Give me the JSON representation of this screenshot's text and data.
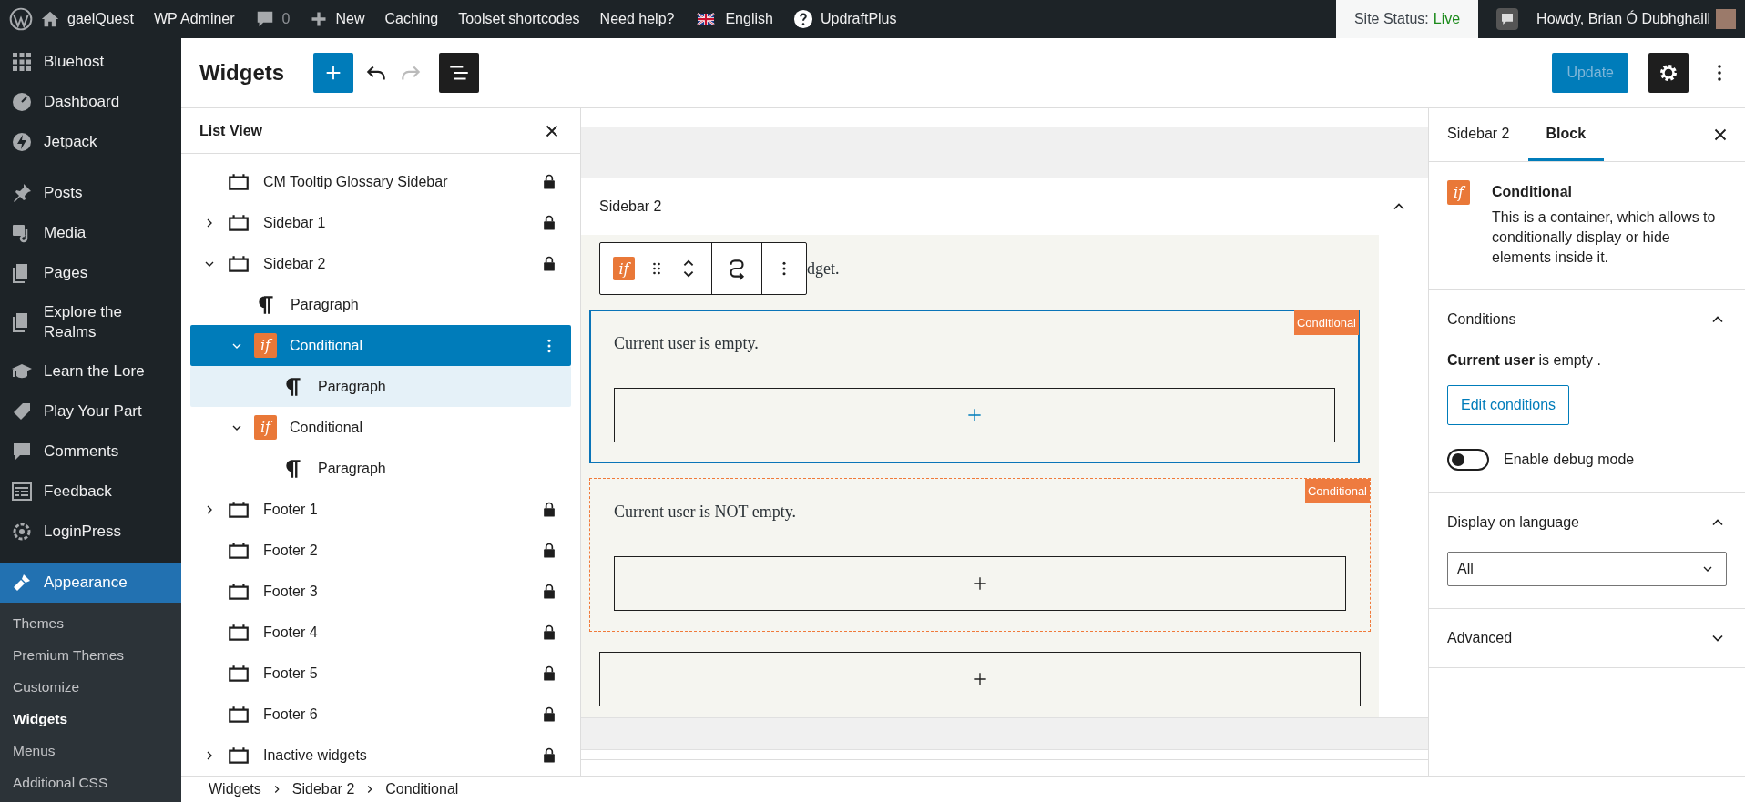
{
  "admin_bar": {
    "left": [
      {
        "kind": "wp-logo"
      },
      {
        "kind": "home",
        "label": "gaelQuest"
      },
      {
        "kind": "text",
        "label": "WP Adminer"
      },
      {
        "kind": "comments",
        "label": "0"
      },
      {
        "kind": "new",
        "label": "New"
      },
      {
        "kind": "text",
        "label": "Caching"
      },
      {
        "kind": "text",
        "label": "Toolset shortcodes"
      },
      {
        "kind": "text",
        "label": "Need help?"
      },
      {
        "kind": "language",
        "label": "English"
      },
      {
        "kind": "text",
        "label": "UpdraftPlus"
      }
    ],
    "site_status": {
      "label": "Site Status:",
      "value": "Live"
    },
    "howdy": "Howdy, Brian Ó Dubhghaill"
  },
  "admin_menu": {
    "groups": [
      [
        {
          "label": "Bluehost",
          "current": false
        },
        {
          "label": "Dashboard",
          "current": false
        },
        {
          "label": "Jetpack",
          "current": false
        }
      ],
      [
        {
          "label": "Posts",
          "current": false
        },
        {
          "label": "Media",
          "current": false
        },
        {
          "label": "Pages",
          "current": false
        },
        {
          "label": "Explore the Realms",
          "current": false
        },
        {
          "label": "Learn the Lore",
          "current": false
        },
        {
          "label": "Play Your Part",
          "current": false
        },
        {
          "label": "Comments",
          "current": false
        },
        {
          "label": "Feedback",
          "current": false
        },
        {
          "label": "LoginPress",
          "current": false
        }
      ],
      [
        {
          "label": "Appearance",
          "current": true
        }
      ]
    ],
    "submenu": [
      {
        "label": "Themes",
        "selected": false
      },
      {
        "label": "Premium Themes",
        "selected": false
      },
      {
        "label": "Customize",
        "selected": false
      },
      {
        "label": "Widgets",
        "selected": true
      },
      {
        "label": "Menus",
        "selected": false
      },
      {
        "label": "Additional CSS",
        "selected": false
      }
    ]
  },
  "header": {
    "title": "Widgets",
    "update": "Update"
  },
  "list_view": {
    "title": "List View",
    "items": [
      {
        "kind": "widget-area",
        "label": "CM Tooltip Glossary Sidebar",
        "locked": true,
        "selected": false,
        "highlighted": false
      },
      {
        "kind": "widget-area",
        "label": "Sidebar 1",
        "expanded": false,
        "locked": true,
        "selected": false,
        "highlighted": false
      },
      {
        "kind": "widget-area",
        "label": "Sidebar 2",
        "expanded": true,
        "locked": true,
        "selected": false,
        "highlighted": false,
        "children": [
          {
            "kind": "paragraph",
            "label": "Paragraph",
            "locked": false,
            "selected": false,
            "highlighted": false
          },
          {
            "kind": "conditional",
            "icon_label": "if",
            "label": "Conditional",
            "expanded": true,
            "locked": false,
            "selected": true,
            "highlighted": false,
            "children": [
              {
                "kind": "paragraph",
                "label": "Paragraph",
                "locked": false,
                "selected": false,
                "highlighted": true
              }
            ]
          },
          {
            "kind": "conditional",
            "icon_label": "if",
            "label": "Conditional",
            "expanded": true,
            "locked": false,
            "selected": false,
            "highlighted": false,
            "children": [
              {
                "kind": "paragraph",
                "label": "Paragraph",
                "locked": false,
                "selected": false,
                "highlighted": false
              }
            ]
          }
        ]
      },
      {
        "kind": "widget-area",
        "label": "Footer 1",
        "expanded": false,
        "locked": true,
        "selected": false,
        "highlighted": false
      },
      {
        "kind": "widget-area",
        "label": "Footer 2",
        "locked": true,
        "selected": false,
        "highlighted": false
      },
      {
        "kind": "widget-area",
        "label": "Footer 3",
        "locked": true,
        "selected": false,
        "highlighted": false
      },
      {
        "kind": "widget-area",
        "label": "Footer 4",
        "locked": true,
        "selected": false,
        "highlighted": false
      },
      {
        "kind": "widget-area",
        "label": "Footer 5",
        "locked": true,
        "selected": false,
        "highlighted": false
      },
      {
        "kind": "widget-area",
        "label": "Footer 6",
        "locked": true,
        "selected": false,
        "highlighted": false
      },
      {
        "kind": "widget-area",
        "label": "Inactive widgets",
        "expanded": false,
        "locked": true,
        "selected": false,
        "highlighted": false
      }
    ]
  },
  "canvas": {
    "area_title": "Sidebar 2",
    "toolbar": {
      "icon_label": "if"
    },
    "partial_text": "dget.",
    "blocks": [
      {
        "label": "Conditional",
        "text": "Current user is empty.",
        "selected": true
      },
      {
        "label": "Conditional",
        "text": "Current user is NOT empty.",
        "selected": false
      }
    ]
  },
  "breadcrumb": [
    "Widgets",
    "Sidebar 2",
    "Conditional"
  ],
  "inspector": {
    "tabs": [
      {
        "label": "Sidebar 2",
        "selected": false
      },
      {
        "label": "Block",
        "selected": true
      }
    ],
    "block": {
      "icon_label": "if",
      "name": "Conditional",
      "description": "This is a container, which allows to conditionally display or hide elements inside it."
    },
    "panels": [
      {
        "kind": "conditions",
        "title": "Conditions",
        "expanded": true,
        "summary": "**Current user** is empty .",
        "button": "Edit conditions",
        "toggle_label": "Enable debug mode",
        "toggle_on": false
      },
      {
        "kind": "select",
        "title": "Display on language",
        "expanded": true,
        "value": "All"
      },
      {
        "kind": "plain",
        "title": "Advanced",
        "expanded": false
      }
    ]
  }
}
